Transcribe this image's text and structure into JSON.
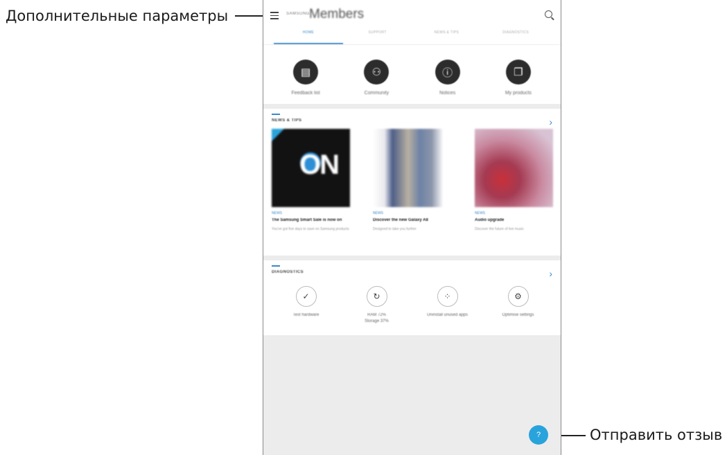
{
  "callouts": {
    "menu_label": "Дополнительные параметры",
    "feedback_label": "Отправить отзыв"
  },
  "app_bar": {
    "brand": "SAMSUNG",
    "title": "Members",
    "menu_icon": "hamburger-icon",
    "search_icon": "search-icon"
  },
  "tabs": [
    {
      "label": "HOME",
      "active": true
    },
    {
      "label": "SUPPORT",
      "active": false
    },
    {
      "label": "NEWS & TIPS",
      "active": false
    },
    {
      "label": "DIAGNOSTICS",
      "active": false
    }
  ],
  "shortcuts": [
    {
      "label": "Feedback list",
      "icon": "document-icon",
      "glyph": "▤"
    },
    {
      "label": "Community",
      "icon": "community-icon",
      "glyph": "⚇"
    },
    {
      "label": "Notices",
      "icon": "info-icon",
      "glyph": "ⓘ"
    },
    {
      "label": "My products",
      "icon": "devices-icon",
      "glyph": "❐"
    }
  ],
  "news": {
    "title": "NEWS & TIPS",
    "items": [
      {
        "tag": "NEWS",
        "title": "The Samsung Smart Sale is now on",
        "desc": "You've got five days to save on Samsung products"
      },
      {
        "tag": "NEWS",
        "title": "Discover the new Galaxy A8",
        "desc": "Designed to take you further"
      },
      {
        "tag": "NEWS",
        "title": "Audio upgrade",
        "desc": "Discover the future of live music"
      }
    ]
  },
  "diagnostics": {
    "title": "DIAGNOSTICS",
    "items": [
      {
        "label": "Test hardware",
        "icon": "check-icon",
        "glyph": "✓"
      },
      {
        "label": "RAM 72%\nStorage 37%",
        "icon": "refresh-icon",
        "glyph": "↻"
      },
      {
        "label": "Uninstall unused apps",
        "icon": "apps-grid-icon",
        "glyph": "⁘"
      },
      {
        "label": "Optimise settings",
        "icon": "gear-icon",
        "glyph": "⚙"
      }
    ]
  },
  "help_button": {
    "label": "?",
    "icon": "help-icon"
  },
  "colors": {
    "accent": "#3a88c9",
    "fab": "#29a3db",
    "dark_icon": "#2c2c2c",
    "background": "#ececec"
  }
}
